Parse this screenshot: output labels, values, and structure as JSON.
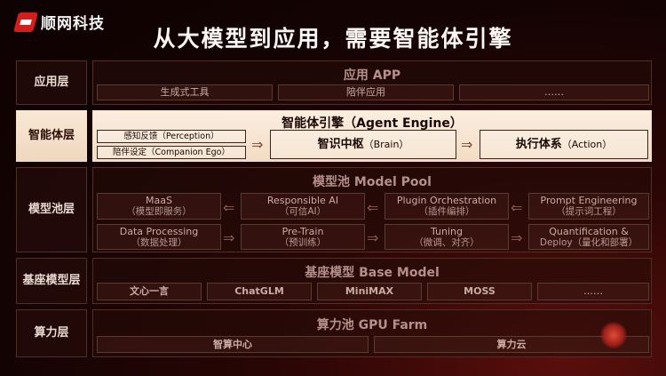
{
  "header": {
    "brand": "顺网科技",
    "title": "从大模型到应用，需要智能体引擎"
  },
  "layers": {
    "app": {
      "label": "应用层",
      "title": "应用 APP",
      "items": [
        "生成式工具",
        "陪伴应用",
        "……"
      ]
    },
    "agent": {
      "label": "智能体层",
      "title": "智能体引擎（Agent Engine）",
      "perception": "感知反馈（Perception）",
      "companion": "陪伴设定（Companion Ego）",
      "brain_main": "智识中枢",
      "brain_sub": "（Brain）",
      "action_main": "执行体系",
      "action_sub": "（Action）"
    },
    "model_pool": {
      "label": "模型池层",
      "title": "模型池 Model Pool",
      "row1": [
        {
          "main": "MaaS",
          "sub": "（模型即服务）"
        },
        {
          "main": "Responsible AI",
          "sub": "（可信AI）"
        },
        {
          "main": "Plugin Orchestration",
          "sub": "（插件编排）"
        },
        {
          "main": "Prompt Engineering",
          "sub": "（提示词工程）"
        }
      ],
      "row2": [
        {
          "main": "Data Processing",
          "sub": "（数据处理）"
        },
        {
          "main": "Pre-Train",
          "sub": "（预训练）"
        },
        {
          "main": "Tuning",
          "sub": "（微调、对齐）"
        },
        {
          "main": "Quantification &",
          "sub": "Deploy（量化和部署）"
        }
      ]
    },
    "base": {
      "label": "基座\n模型层",
      "label_line1": "基座",
      "label_line2": "模型层",
      "title": "基座模型 Base Model",
      "items": [
        "文心一言",
        "ChatGLM",
        "MiniMAX",
        "MOSS",
        "……"
      ]
    },
    "gpu": {
      "label": "算力层",
      "title": "算力池 GPU Farm",
      "items": [
        "智算中心",
        "算力云"
      ]
    }
  }
}
